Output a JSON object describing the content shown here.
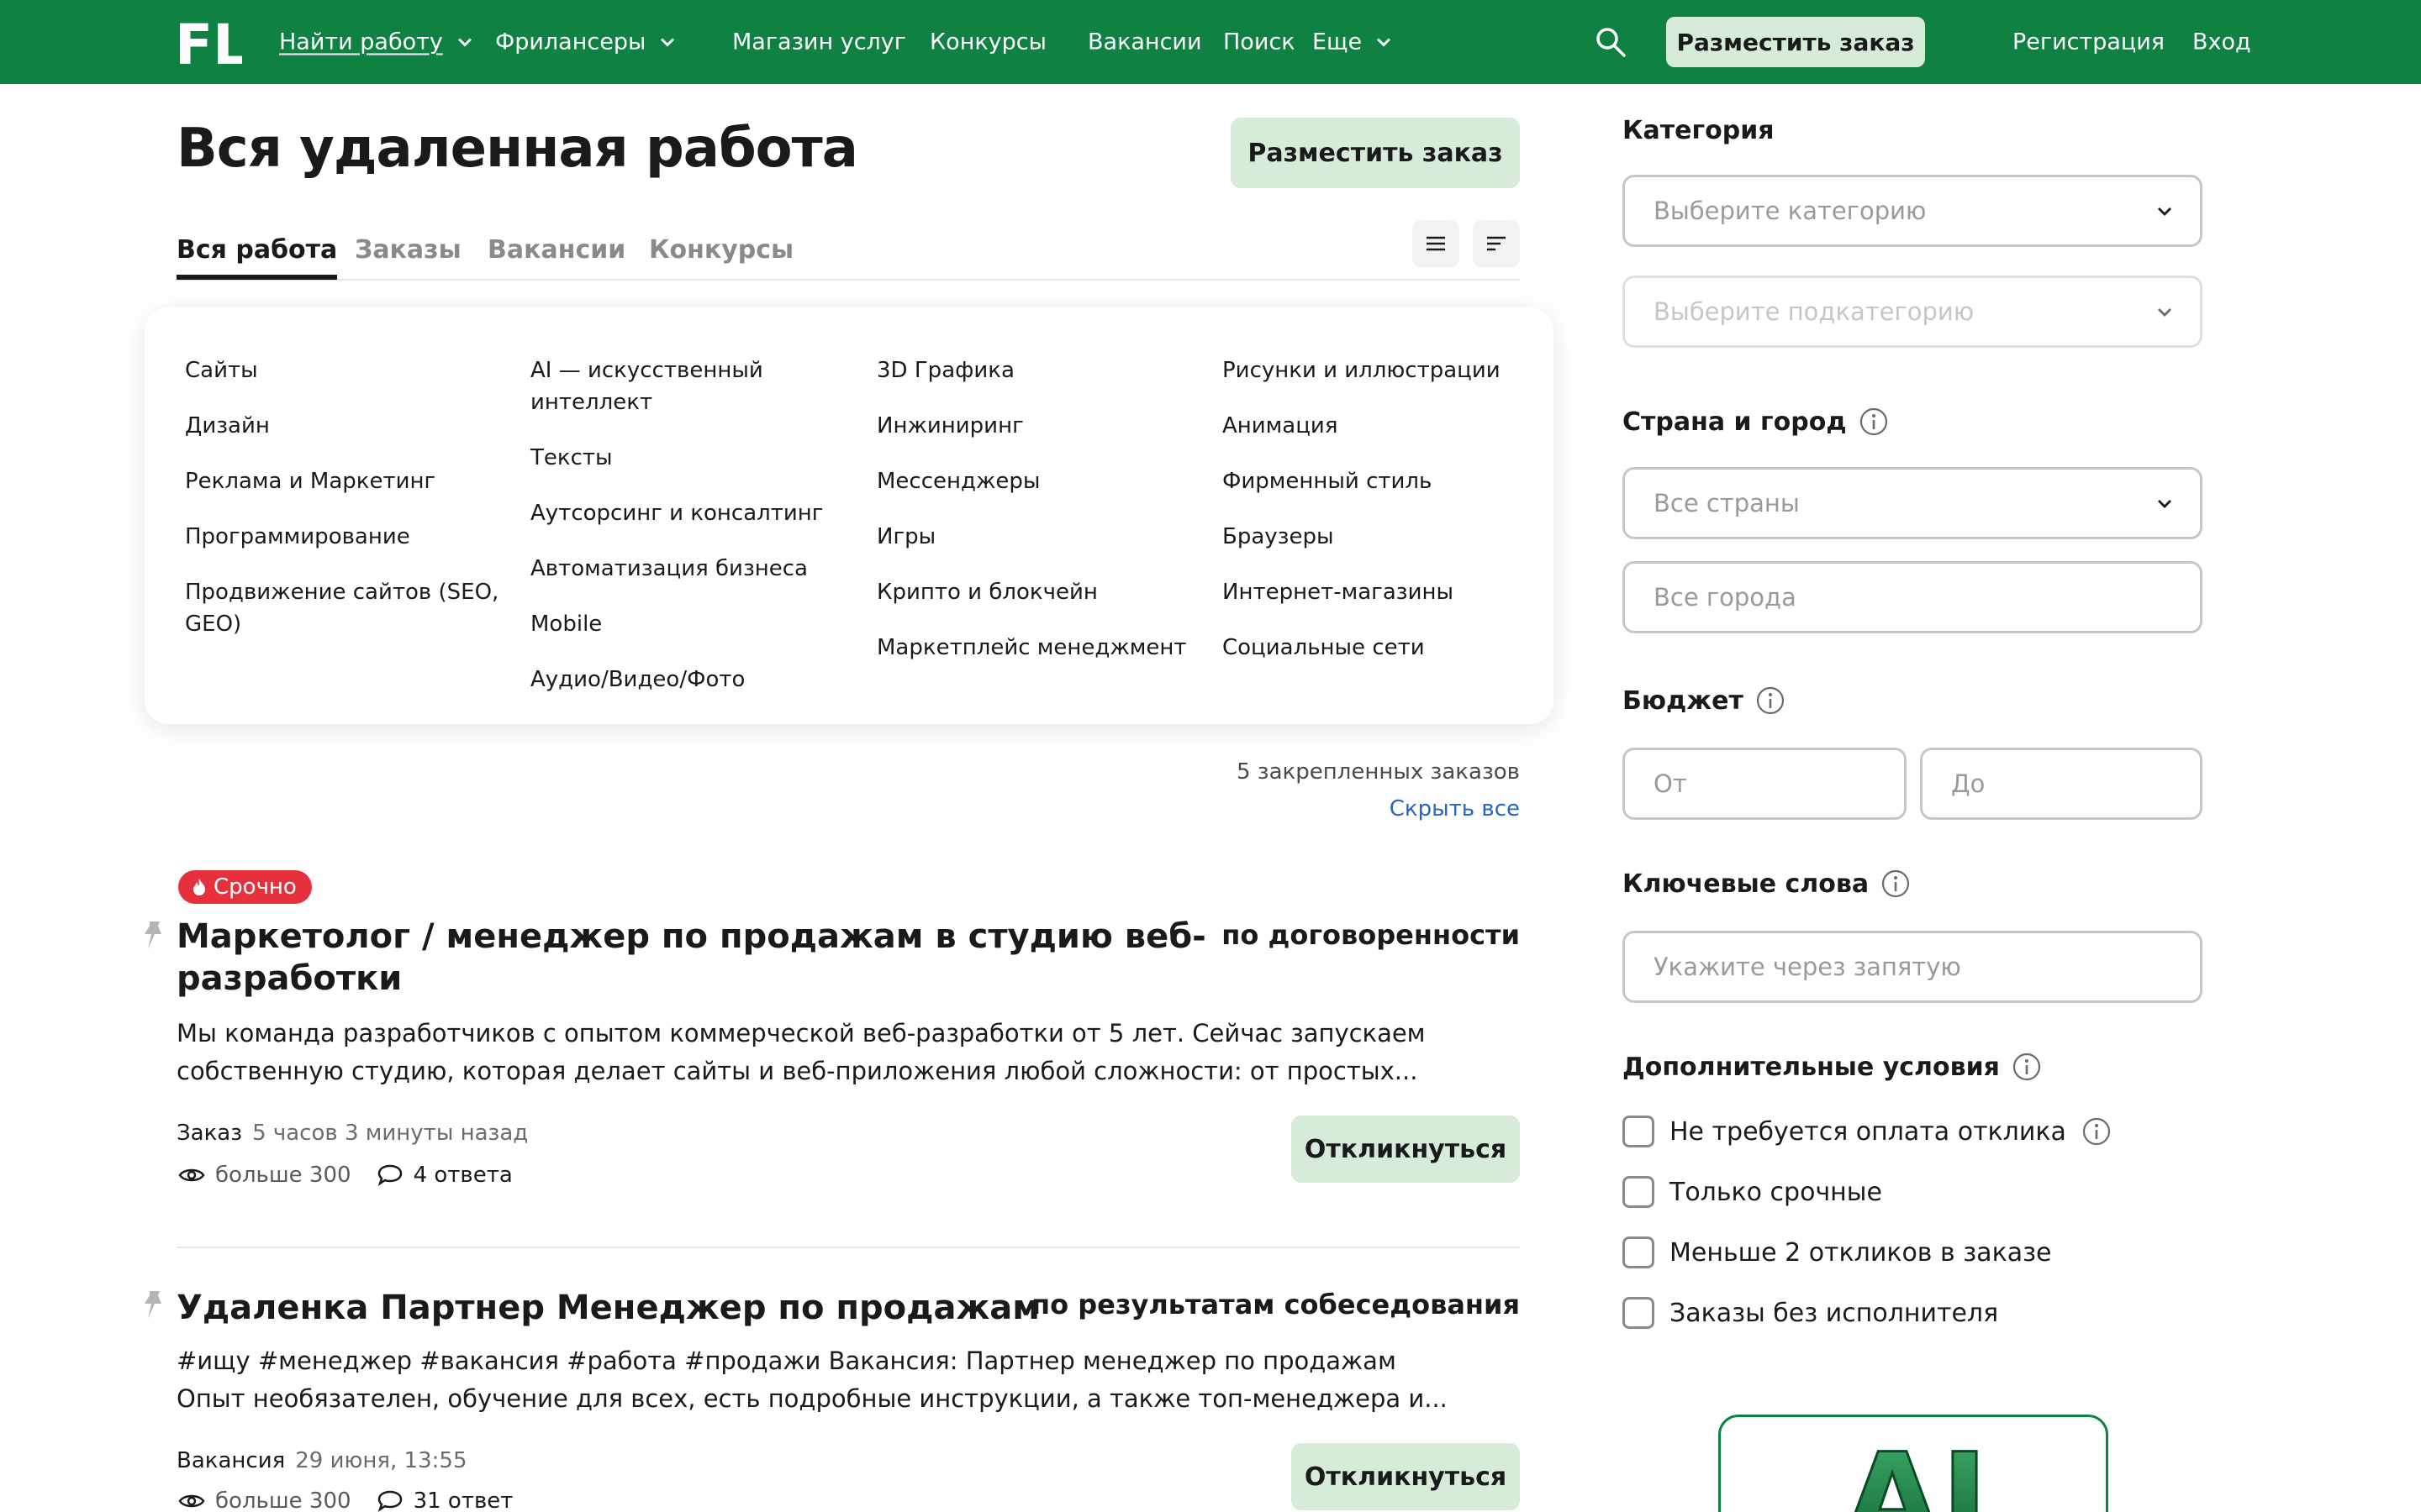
{
  "header": {
    "logo_text": "FL",
    "nav": [
      {
        "label": "Найти работу",
        "dropdown": true,
        "active": true
      },
      {
        "label": "Фрилансеры",
        "dropdown": true
      },
      {
        "label": "Магазин услуг"
      },
      {
        "label": "Конкурсы"
      },
      {
        "label": "Вакансии"
      },
      {
        "label": "Поиск"
      },
      {
        "label": "Еще",
        "dropdown": true
      }
    ],
    "post_order": "Разместить заказ",
    "register": "Регистрация",
    "login": "Вход"
  },
  "main": {
    "title": "Вся удаленная работа",
    "post_order": "Разместить заказ",
    "tabs": [
      "Вся работа",
      "Заказы",
      "Вакансии",
      "Конкурсы"
    ],
    "categories": [
      [
        "Сайты",
        "Дизайн",
        "Реклама и Маркетинг",
        "Программирование",
        "Продвижение сайтов (SEO, GEO)"
      ],
      [
        "AI — искусственный интеллект",
        "Тексты",
        "Аутсорсинг и консалтинг",
        "Автоматизация бизнеса",
        "Mobile",
        "Аудио/Видео/Фото"
      ],
      [
        "3D Графика",
        "Инжиниринг",
        "Мессенджеры",
        "Игры",
        "Крипто и блокчейн",
        "Маркетплейс менеджмент"
      ],
      [
        "Рисунки и иллюстрации",
        "Анимация",
        "Фирменный стиль",
        "Браузеры",
        "Интернет-магазины",
        "Социальные сети"
      ]
    ],
    "pinned_count": "5 закрепленных заказов",
    "hide_all": "Скрыть все",
    "jobs": [
      {
        "badge": "Срочно",
        "title": "Маркетолог / менеджер по продажам в студию веб-разработки",
        "budget": "по договоренности",
        "description": "Мы команда разработчиков с опытом коммерческой веб-разработки от 5 лет. Сейчас запускаем собственную студию, которая делает сайты и веб-приложения любой сложности: от простых...",
        "type": "Заказ",
        "time": "5 часов 3 минуты назад",
        "views": "больше 300",
        "answers": "4 ответа",
        "reply": "Откликнуться"
      },
      {
        "title": "Удаленка Партнер Менеджер по продажам",
        "budget": "по результатам собеседования",
        "description": "#ищу #менеджер #вакансия #работа #продажи  Вакансия: Партнер менеджер по продажам  Опыт необязателен, обучение для всех, есть подробные инструкции, а также топ-менеджера  и...",
        "type": "Вакансия",
        "time": "29 июня, 13:55",
        "views": "больше 300",
        "answers": "31 ответ",
        "reply": "Откликнуться"
      }
    ]
  },
  "sidebar": {
    "category_h": "Категория",
    "category_ph": "Выберите категорию",
    "subcategory_ph": "Выберите подкатегорию",
    "location_h": "Страна и город",
    "countries_ph": "Все страны",
    "cities_ph": "Все города",
    "budget_h": "Бюджет",
    "budget_from": "От",
    "budget_to": "До",
    "keywords_h": "Ключевые слова",
    "keywords_ph": "Укажите через запятую",
    "conditions_h": "Дополнительные условия",
    "conditions": [
      "Не требуется оплата отклика",
      "Только срочные",
      "Меньше 2 откликов в заказе",
      "Заказы без исполнителя"
    ],
    "promo_text": "AI"
  },
  "colors": {
    "brand": "#0f8142",
    "button_bg": "#d6ecd9",
    "urgent": "#e6303b",
    "link": "#2466c7"
  }
}
